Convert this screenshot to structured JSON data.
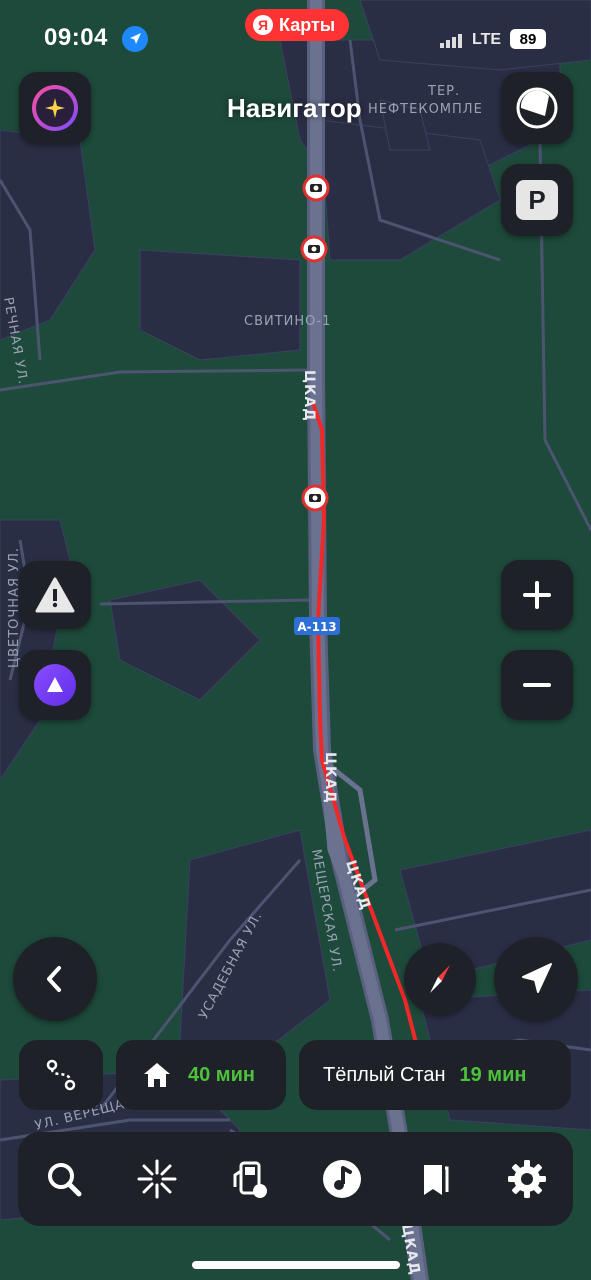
{
  "status_bar": {
    "time": "09:04",
    "brand_logo": "Я",
    "brand_label": "Карты",
    "carrier": "LTE",
    "battery": "89"
  },
  "header": {
    "title": "Навигатор"
  },
  "map": {
    "labels": {
      "area_ter": "ТЕР.",
      "area_ter2": "НЕФТЕКОМПЛЕ",
      "svitino": "СВИТИНО-1",
      "ckad1": "ЦКАД",
      "ckad2": "ЦКАД",
      "ckad3": "ЦКАД",
      "ckad4": "ЦКАД",
      "road_number": "А-113",
      "rechnaya": "РЕЧНАЯ УЛ.",
      "tsvetochnaya": "ЦВЕТОЧНАЯ УЛ.",
      "meshcherskaya": "МЕЩЕРСКАЯ УЛ.",
      "usadebnaya": "УСАДЕБНАЯ УЛ.",
      "vereshch": "УЛ. ВЕРЕЩАГИНА"
    }
  },
  "destinations": {
    "home_time": "40 мин",
    "place_name": "Тёплый Стан",
    "place_time": "19 мин"
  },
  "colors": {
    "map_bg": "#1d4a3b",
    "road": "#3a3f57",
    "route": "#f02828",
    "panel": "#1f2128",
    "eta_green": "#4cc13c"
  },
  "icons": {
    "profile": "sparkles-icon",
    "layers": "layers-icon",
    "parking": "parking-icon",
    "alert": "warning-icon",
    "alice": "alice-icon",
    "zoom_in": "plus-icon",
    "zoom_out": "minus-icon",
    "back": "chevron-left-icon",
    "compass": "compass-icon",
    "locate": "navigation-arrow-icon",
    "route_options": "route-icon",
    "home": "home-icon",
    "search": "search-icon",
    "discover": "sparkle-burst-icon",
    "fuel": "fuel-icon",
    "music": "music-icon",
    "bookmarks": "bookmarks-icon",
    "settings": "gear-icon",
    "parking_letter": "P"
  }
}
